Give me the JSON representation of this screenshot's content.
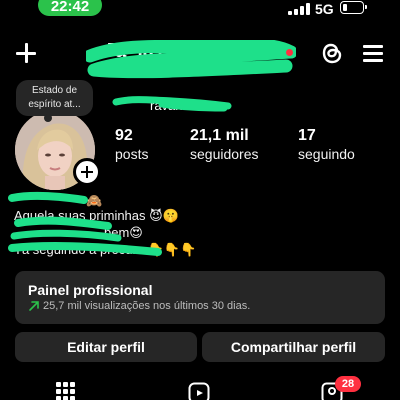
{
  "status_bar": {
    "time": "22:42",
    "network": "5G",
    "battery_level": 0.25
  },
  "header": {
    "username": "Ja_ia1_na",
    "icons": [
      "plus-icon",
      "threads-icon",
      "menu-icon"
    ]
  },
  "profile": {
    "note": [
      "Estado de",
      "espírito at..."
    ],
    "display_name": "ravanel",
    "stats": [
      {
        "value": "92",
        "label": "posts"
      },
      {
        "value": "21,1 mil",
        "label": "seguidores"
      },
      {
        "value": "17",
        "label": "seguindo"
      }
    ]
  },
  "bio": {
    "lines": [
      "🙈",
      "Aquela suas priminhas 😈🤫",
      "bem😍",
      "Tá seguindo a procura 👇👇👇"
    ]
  },
  "professional_panel": {
    "title": "Painel profissional",
    "subtitle": "25,7 mil visualizações nos últimos 30 dias."
  },
  "actions": {
    "edit_label": "Editar perfil",
    "share_label": "Compartilhar perfil"
  },
  "tabs": {
    "badge": "28",
    "icons": [
      "grid-icon",
      "reels-icon",
      "tagged-icon"
    ]
  },
  "colors": {
    "background": "#000000",
    "accent_green": "#2bc24b",
    "redaction_green": "#1ee08a",
    "badge_red": "#ff3040",
    "panel": "#262626"
  }
}
